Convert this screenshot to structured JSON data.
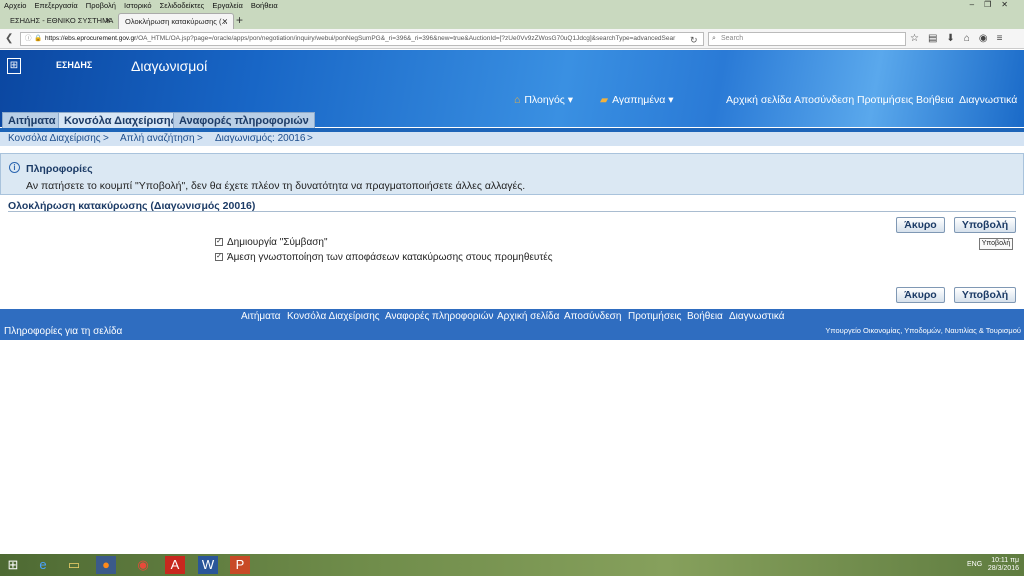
{
  "browser": {
    "menu": [
      "Αρχείο",
      "Επεξεργασία",
      "Προβολή",
      "Ιστορικό",
      "Σελιδοδείκτες",
      "Εργαλεία",
      "Βοήθεια"
    ],
    "tabs": [
      {
        "title": "ΕΣΗΔΗΣ - ΕΘΝΙΚΟ ΣΥΣΤΗΜΑ ..."
      },
      {
        "title": "Ολοκλήρωση κατακύρωσης (..."
      }
    ],
    "url_domain": "https://ebs.eprocurement.gov.gr",
    "url_path": "/OA_HTML/OA.jsp?page=/oracle/apps/pon/negotiation/inquiry/webui/ponNegSumPG&_ri=396&_ri=396&new=true&AuctionId=[?zUe0Vv9zZWosG70uQ1Jdcg]&searchType=advancedSear",
    "search_placeholder": "Search"
  },
  "header": {
    "brand": "ΕΣΗΔΗΣ",
    "title": "Διαγωνισμοί",
    "navigator": "Πλοηγός",
    "favorites": "Αγαπημένα",
    "global_links": [
      "Αρχική σελίδα",
      "Αποσύνδεση",
      "Προτιμήσεις",
      "Βοήθεια",
      "Διαγνωστικά"
    ]
  },
  "tabs": [
    "Αιτήματα",
    "Κονσόλα Διαχείρισης",
    "Αναφορές πληροφοριών"
  ],
  "breadcrumbs": [
    "Κονσόλα Διαχείρισης",
    "Απλή αναζήτηση",
    "Διαγωνισμός: 20016"
  ],
  "breadcrumb_sep": ">",
  "info": {
    "title": "Πληροφορίες",
    "message": "Αν πατήσετε το κουμπί \"Υποβολή\", δεν θα έχετε πλέον τη δυνατότητα να πραγματοποιήσετε άλλες αλλαγές."
  },
  "page_title": "Ολοκλήρωση κατακύρωσης (Διαγωνισμός 20016)",
  "buttons": {
    "cancel": "Άκυρο",
    "submit": "Υποβολή"
  },
  "tooltip": "Υποβολή",
  "options": [
    {
      "label": "Δημιουργία \"Σύμβαση\"",
      "checked": true
    },
    {
      "label": "Άμεση γνωστοποίηση των αποφάσεων κατακύρωσης στους προμηθευτές",
      "checked": true
    }
  ],
  "footer": {
    "links": [
      "Αιτήματα",
      "Κονσόλα Διαχείρισης",
      "Αναφορές πληροφοριών",
      "Αρχική σελίδα",
      "Αποσύνδεση",
      "Προτιμήσεις",
      "Βοήθεια",
      "Διαγνωστικά"
    ],
    "page_info": "Πληροφορίες για τη σελίδα",
    "ministry": "Υπουργείο Οικονομίας, Υποδομών, Ναυτιλίας & Τουρισμού"
  },
  "taskbar": {
    "lang": "ENG",
    "time": "10:11 πμ",
    "date": "28/3/2016",
    "icons": [
      "windows-start-icon",
      "ie-icon",
      "explorer-icon",
      "firefox-icon",
      "chrome-icon",
      "acrobat-icon",
      "word-icon",
      "powerpoint-icon"
    ]
  },
  "colors": {
    "header_blue": "#1866c6",
    "tab_bg": "#b9cfe6",
    "footer_blue": "#2f6dc0",
    "info_bg": "#dbe8f3"
  }
}
